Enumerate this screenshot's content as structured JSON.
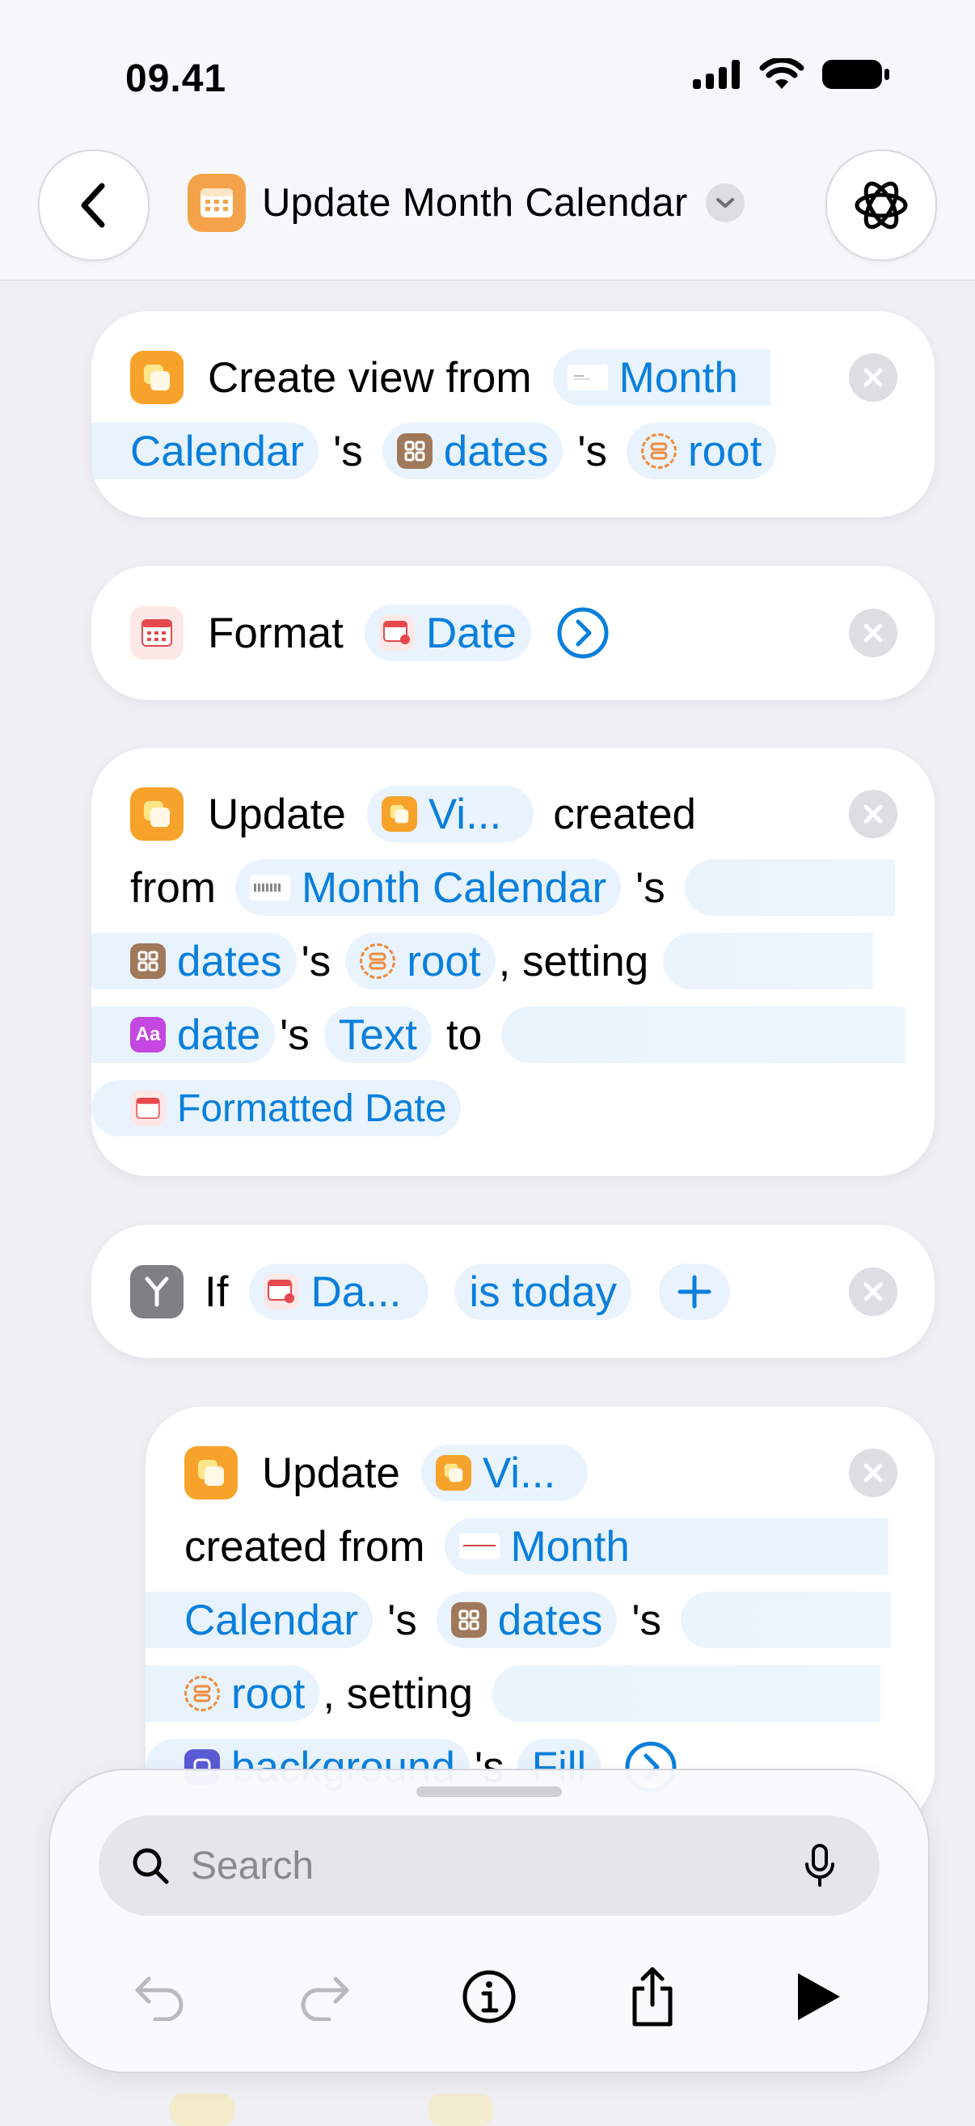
{
  "status": {
    "time": "09.41"
  },
  "header": {
    "title": "Update Month Calendar"
  },
  "actions": {
    "create_view": {
      "verb": "Create view from",
      "month_a": "Month",
      "month_b": "Calendar",
      "possessive1": "'s",
      "dates": "dates",
      "possessive2": "'s",
      "root": "root"
    },
    "format": {
      "verb": "Format",
      "date": "Date"
    },
    "update1": {
      "verb": "Update",
      "view": "Vi...",
      "created": "created",
      "from": "from",
      "month_calendar": "Month Calendar",
      "possessive1": "'s",
      "dates": "dates",
      "possessive2": "'s",
      "root": "root",
      "setting": ", setting",
      "date": "date",
      "possessive3": "'s",
      "text": "Text",
      "to": "to",
      "formatted_date": "Formatted Date"
    },
    "if_block": {
      "verb": "If",
      "date": "Da...",
      "condition": "is today"
    },
    "update2": {
      "verb": "Update",
      "view": "Vi...",
      "created_from": "created from",
      "month": "Month",
      "calendar": "Calendar",
      "possessive1": "'s",
      "dates": "dates",
      "possessive2": "'s",
      "root": "root",
      "setting": ", setting",
      "background": "background",
      "possessive3": "'s",
      "fill": "Fill"
    }
  },
  "search": {
    "placeholder": "Search"
  },
  "colors": {
    "accent": "#0a7fdc",
    "token_bg": "#e8f3fd",
    "app_orange": "#f5a34a"
  }
}
